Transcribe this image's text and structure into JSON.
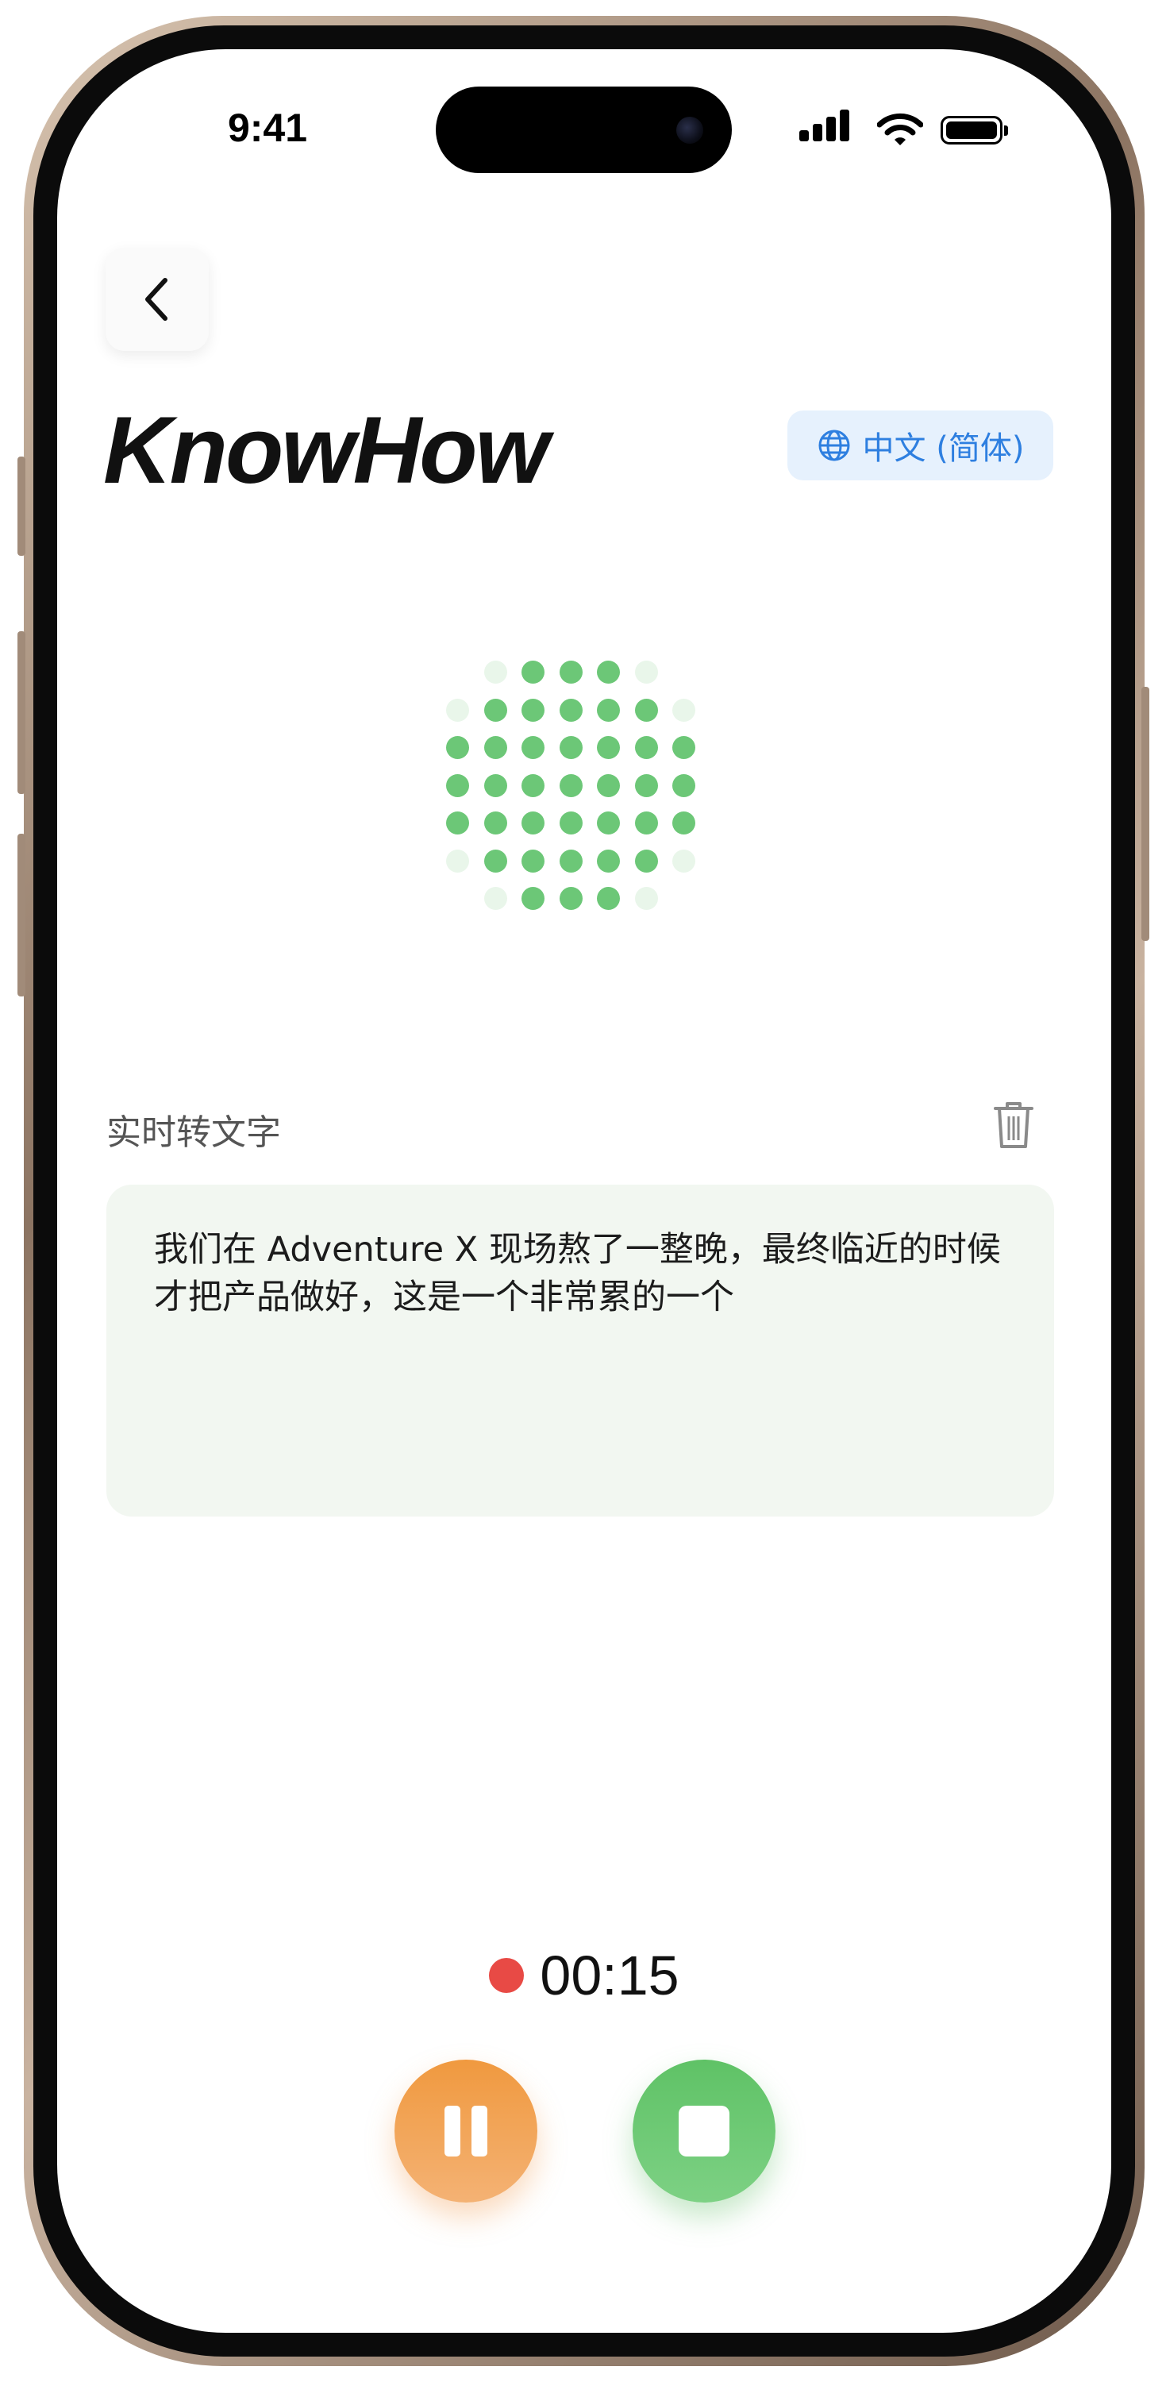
{
  "status_bar": {
    "time": "9:41",
    "signal_icon": "cellular-signal-icon",
    "wifi_icon": "wifi-icon",
    "battery_icon": "battery-full-icon"
  },
  "header": {
    "back_icon": "chevron-left-icon",
    "app_title": "KnowHow",
    "language_icon": "globe-icon",
    "language_label": "中文 (简体)"
  },
  "visualizer": {
    "active_color": "#6cc777",
    "inactive_color": "#e9f6ea"
  },
  "transcript": {
    "section_label": "实时转文字",
    "delete_icon": "trash-icon",
    "text": "我们在 Adventure X 现场熬了一整晚，最终临近的时候才把产品做好，这是一个非常累的一个"
  },
  "recording": {
    "indicator_color": "#e84a45",
    "elapsed": "00:15",
    "pause_icon": "pause-icon",
    "stop_icon": "stop-icon"
  },
  "colors": {
    "pause_button": "#f0993f",
    "stop_button": "#5fc266",
    "language_accent": "#2e7fe0"
  }
}
